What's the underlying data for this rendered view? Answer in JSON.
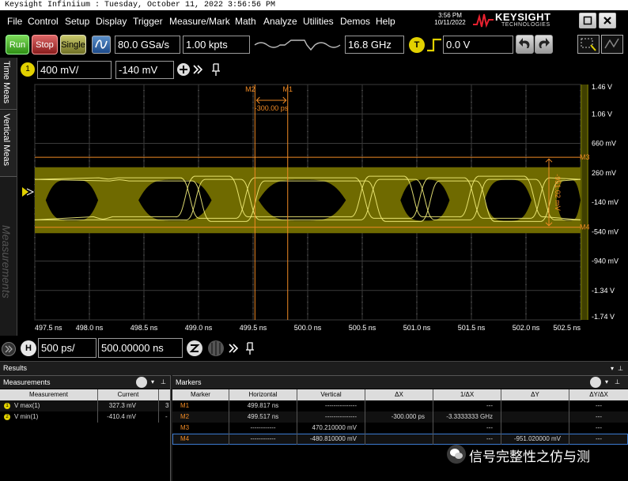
{
  "window": {
    "title": "Keysight Infiniium : Tuesday, October 11, 2022 3:56:56 PM"
  },
  "menu": [
    "File",
    "Control",
    "Setup",
    "Display",
    "Trigger",
    "Measure/Mark",
    "Math",
    "Analyze",
    "Utilities",
    "Demos",
    "Help"
  ],
  "clock": {
    "time": "3:56 PM",
    "date": "10/11/2022"
  },
  "brand": {
    "name": "KEYSIGHT",
    "sub": "TECHNOLOGIES"
  },
  "toolbar": {
    "run": "Run",
    "stop": "Stop",
    "single": "Single",
    "sample_rate": "80.0 GSa/s",
    "memory_depth": "1.00 kpts",
    "bandwidth": "16.8 GHz",
    "trigger_badge": "T",
    "trigger_level": "0.0 V"
  },
  "side_tabs": [
    "Time Meas",
    "Vertical Meas",
    "Measurements"
  ],
  "channel": {
    "number": "1",
    "scale": "400 mV/",
    "offset": "-140 mV"
  },
  "scope": {
    "y_labels": [
      "1.46 V",
      "1.06 V",
      "660 mV",
      "260 mV",
      "-140 mV",
      "-540 mV",
      "-940 mV",
      "-1.34 V",
      "-1.74 V"
    ],
    "x_labels": [
      "497.5 ns",
      "498.0 ns",
      "498.5 ns",
      "499.0 ns",
      "499.5 ns",
      "500.0 ns",
      "500.5 ns",
      "501.0 ns",
      "501.5 ns",
      "502.0 ns",
      "502.5 ns"
    ],
    "markers": {
      "m1": "M1",
      "m2": "M2",
      "m3": "M3",
      "m4": "M4"
    },
    "delta_x": "-300.00 ps",
    "delta_y": "-951.02 mV",
    "colors": {
      "trace": "#d4d000",
      "marker": "#f08a24",
      "grid": "#3a3a3a"
    }
  },
  "timebase": {
    "badge": "H",
    "scale": "500 ps/",
    "position": "500.00000 ns"
  },
  "results": {
    "title": "Results"
  },
  "measurements": {
    "title": "Measurements",
    "headers": [
      "Measurement",
      "Current",
      ""
    ],
    "rows": [
      {
        "name": "V max(1)",
        "current": "327.3 mV",
        "extra": "3"
      },
      {
        "name": "V min(1)",
        "current": "-410.4 mV",
        "extra": "-"
      }
    ]
  },
  "markers_table": {
    "title": "Markers",
    "headers": [
      "Marker",
      "Horizontal",
      "Vertical",
      "ΔX",
      "1/ΔX",
      "ΔY",
      "ΔY/ΔX"
    ],
    "rows": [
      {
        "marker": "M1",
        "horizontal": "499.817 ns",
        "vertical": "---------------",
        "dx": "",
        "inv_dx": "---",
        "dy": "",
        "dydx": "---"
      },
      {
        "marker": "M2",
        "horizontal": "499.517 ns",
        "vertical": "---------------",
        "dx": "-300.000 ps",
        "inv_dx": "-3.3333333 GHz",
        "dy": "",
        "dydx": "---"
      },
      {
        "marker": "M3",
        "horizontal": "------------",
        "vertical": "470.210000 mV",
        "dx": "",
        "inv_dx": "---",
        "dy": "",
        "dydx": "---"
      },
      {
        "marker": "M4",
        "horizontal": "------------",
        "vertical": "-480.810000 mV",
        "dx": "",
        "inv_dx": "---",
        "dy": "-951.020000 mV",
        "dydx": "---"
      }
    ]
  },
  "watermark": "信号完整性之仿与测"
}
